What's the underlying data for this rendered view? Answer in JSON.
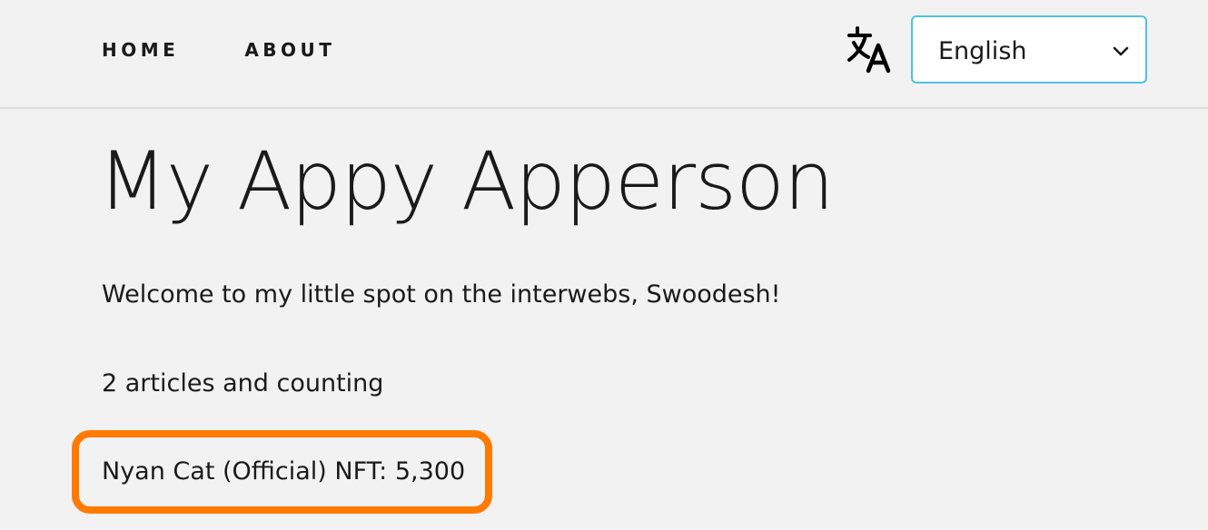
{
  "nav": {
    "items": [
      {
        "label": "HOME"
      },
      {
        "label": "ABOUT"
      }
    ]
  },
  "language": {
    "icon": "translate-icon",
    "selected": "English"
  },
  "main": {
    "title": "My Appy Apperson",
    "welcome": "Welcome to my little spot on the interwebs, Swoodesh!",
    "article_count": "2 articles and counting",
    "nft_text": "Nyan Cat (Official) NFT: 5,300"
  },
  "colors": {
    "background": "#f2f2f2",
    "select_border": "#4fc1e3",
    "highlight": "#ff7a00"
  }
}
